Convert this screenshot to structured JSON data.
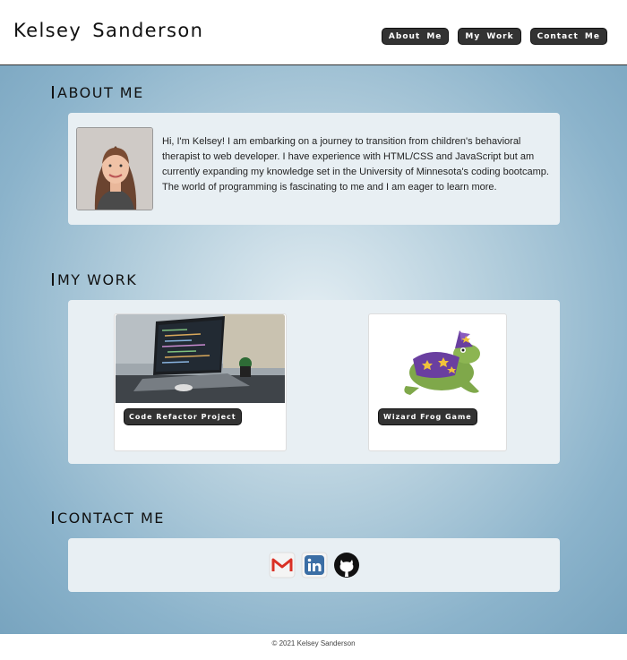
{
  "header": {
    "title": "Kelsey  Sanderson",
    "nav": [
      "About  Me",
      "My  Work",
      "Contact  Me"
    ]
  },
  "about": {
    "heading": "ABOUT ME",
    "text": "Hi, I'm Kelsey! I am embarking on a journey to transition from children's behavioral therapist to web developer. I have experience with HTML/CSS and JavaScript but am currently expanding my knowledge set in the University of Minnesota's coding bootcamp. The world of programming is fascinating to me and I am eager to learn more."
  },
  "work": {
    "heading": "MY WORK",
    "projects": [
      {
        "label": "Code Refactor Project",
        "image": "laptop-code-image"
      },
      {
        "label": "Wizard Frog Game",
        "image": "wizard-frog-image"
      }
    ]
  },
  "contact": {
    "heading": "CONTACT ME",
    "icons": [
      "gmail-icon",
      "linkedin-icon",
      "github-icon"
    ]
  },
  "footer": {
    "text": "© 2021 Kelsey Sanderson"
  },
  "colors": {
    "button": "#333333",
    "panel": "#e8eff3",
    "background_edge": "#78a4bf"
  }
}
